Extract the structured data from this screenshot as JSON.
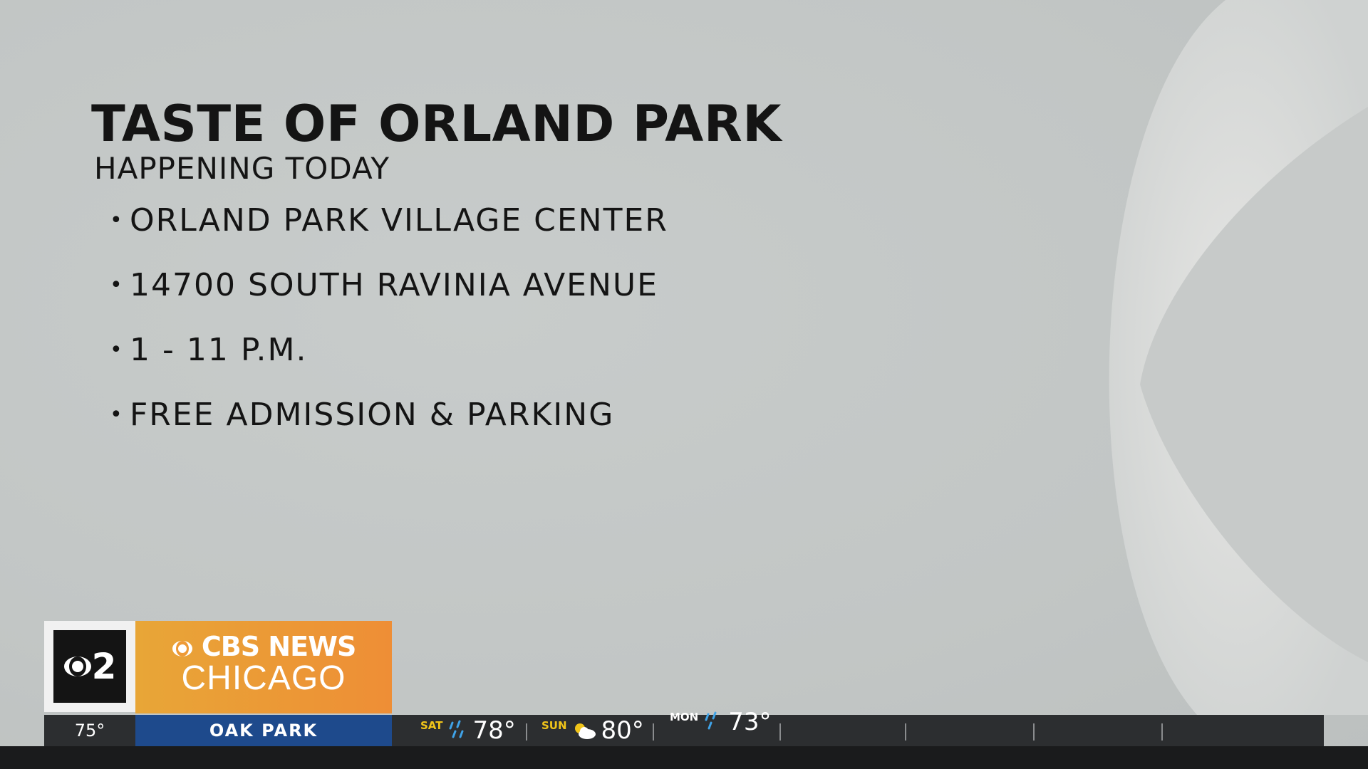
{
  "graphic": {
    "title": "TASTE OF ORLAND PARK",
    "subtitle": "HAPPENING TODAY",
    "bullets": [
      "ORLAND PARK VILLAGE CENTER",
      "14700 SOUTH RAVINIA AVENUE",
      "1 - 11 P.M.",
      "FREE ADMISSION & PARKING"
    ]
  },
  "branding": {
    "station_logo": "2",
    "network": "CBS NEWS",
    "city": "CHICAGO",
    "accent_orange": "#ee8e36",
    "accent_blue": "#1e4a8c"
  },
  "ticker": {
    "current_temp": "75°",
    "location": "OAK PARK",
    "forecast": [
      {
        "day": "SAT",
        "icon": "rain-icon",
        "temp": "78°"
      },
      {
        "day": "SUN",
        "icon": "partly-sunny-icon",
        "temp": "80°"
      },
      {
        "day": "MON",
        "icon": "rain-icon",
        "temp": "73°"
      }
    ]
  }
}
